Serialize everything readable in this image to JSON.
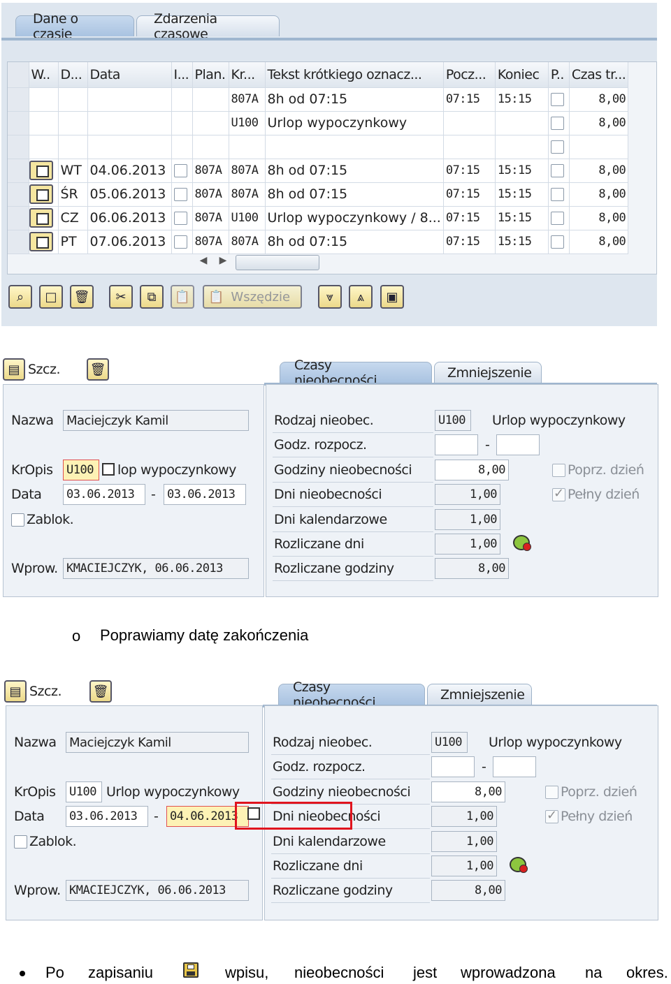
{
  "top": {
    "tabs": [
      "Dane o czasie",
      "Zdarzenia czasowe"
    ],
    "columns": [
      "W..",
      "D...",
      "Data",
      "I...",
      "Plan.",
      "Kr...",
      "Tekst krótkiego oznacz...",
      "Pocz...",
      "Koniec",
      "P..",
      "Czas tr..."
    ],
    "rows": [
      {
        "day": "",
        "date": "",
        "plan": "",
        "kr": "807A",
        "text": "8h od 07:15",
        "start": "07:15",
        "end": "15:15",
        "hours": "8,00",
        "btn": false,
        "icb": false
      },
      {
        "day": "",
        "date": "",
        "plan": "",
        "kr": "U100",
        "text": "Urlop wypoczynkowy",
        "start": "",
        "end": "",
        "hours": "8,00",
        "btn": false,
        "icb": false
      },
      {
        "day": "",
        "date": "",
        "plan": "",
        "kr": "",
        "text": "",
        "start": "",
        "end": "",
        "hours": "",
        "btn": false,
        "icb": false
      },
      {
        "day": "WT",
        "date": "04.06.2013",
        "plan": "807A",
        "kr": "807A",
        "text": "8h od 07:15",
        "start": "07:15",
        "end": "15:15",
        "hours": "8,00",
        "btn": true,
        "icb": true
      },
      {
        "day": "ŚR",
        "date": "05.06.2013",
        "plan": "807A",
        "kr": "807A",
        "text": "8h od 07:15",
        "start": "07:15",
        "end": "15:15",
        "hours": "8,00",
        "btn": true,
        "icb": true
      },
      {
        "day": "CZ",
        "date": "06.06.2013",
        "plan": "807A",
        "kr": "U100",
        "text": "Urlop wypoczynkowy / 8...",
        "start": "07:15",
        "end": "15:15",
        "hours": "8,00",
        "btn": true,
        "icb": true
      },
      {
        "day": "PT",
        "date": "07.06.2013",
        "plan": "807A",
        "kr": "807A",
        "text": "8h od 07:15",
        "start": "07:15",
        "end": "15:15",
        "hours": "8,00",
        "btn": true,
        "icb": true
      }
    ],
    "toolbar_everywhere": "Wszędzie"
  },
  "panel1": {
    "detail_label": "Szcz.",
    "tabs": [
      "Czasy nieobecności",
      "Zmniejszenie"
    ],
    "labels": {
      "name": "Nazwa",
      "kropis": "KrOpis",
      "date": "Data",
      "lock": "Zablok.",
      "entered": "Wprow."
    },
    "values": {
      "name": "Maciejczyk Kamil",
      "code": "U100",
      "code_text": "lop wypoczynkowy",
      "date_from": "03.06.2013",
      "date_to": "03.06.2013",
      "entered": "KMACIEJCZYK, 06.06.2013"
    },
    "right_labels": {
      "type": "Rodzaj nieobec.",
      "start_hour": "Godz. rozpocz.",
      "hours": "Godziny nieobecności",
      "days": "Dni nieobecności",
      "cal_days": "Dni kalendarzowe",
      "calc_days": "Rozliczane dni",
      "calc_hours": "Rozliczane godziny",
      "prev_day": "Poprz. dzień",
      "full_day": "Pełny dzień"
    },
    "right_values": {
      "type_code": "U100",
      "type_text": "Urlop wypoczynkowy",
      "hours": "8,00",
      "days": "1,00",
      "cal_days": "1,00",
      "calc_days": "1,00",
      "calc_hours": "8,00",
      "dash": "-"
    }
  },
  "bullet1": {
    "marker": "o",
    "text": "Poprawiamy datę zakończenia"
  },
  "panel2": {
    "detail_label": "Szcz.",
    "tabs": [
      "Czasy nieobecności",
      "Zmniejszenie"
    ],
    "labels": {
      "name": "Nazwa",
      "kropis": "KrOpis",
      "date": "Data",
      "lock": "Zablok.",
      "entered": "Wprow."
    },
    "values": {
      "name": "Maciejczyk Kamil",
      "code": "U100",
      "code_text": "Urlop wypoczynkowy",
      "date_from": "03.06.2013",
      "date_to": "04.06.2013",
      "entered": "KMACIEJCZYK, 06.06.2013"
    },
    "right_labels": {
      "type": "Rodzaj nieobec.",
      "start_hour": "Godz. rozpocz.",
      "hours": "Godziny nieobecności",
      "days": "Dni nieobecności",
      "cal_days": "Dni kalendarzowe",
      "calc_days": "Rozliczane dni",
      "calc_hours": "Rozliczane godziny",
      "prev_day": "Poprz. dzień",
      "full_day": "Pełny dzień"
    },
    "right_values": {
      "type_code": "U100",
      "type_text": "Urlop wypoczynkowy",
      "hours": "8,00",
      "days": "1,00",
      "cal_days": "1,00",
      "calc_days": "1,00",
      "calc_hours": "8,00",
      "dash": "-"
    },
    "highlight_color": "#e0141e"
  },
  "bullet2": {
    "words": [
      "Po",
      "zapisaniu",
      "wpisu,",
      "nieobecności",
      "jest",
      "wprowadzona",
      "na",
      "okres."
    ]
  }
}
